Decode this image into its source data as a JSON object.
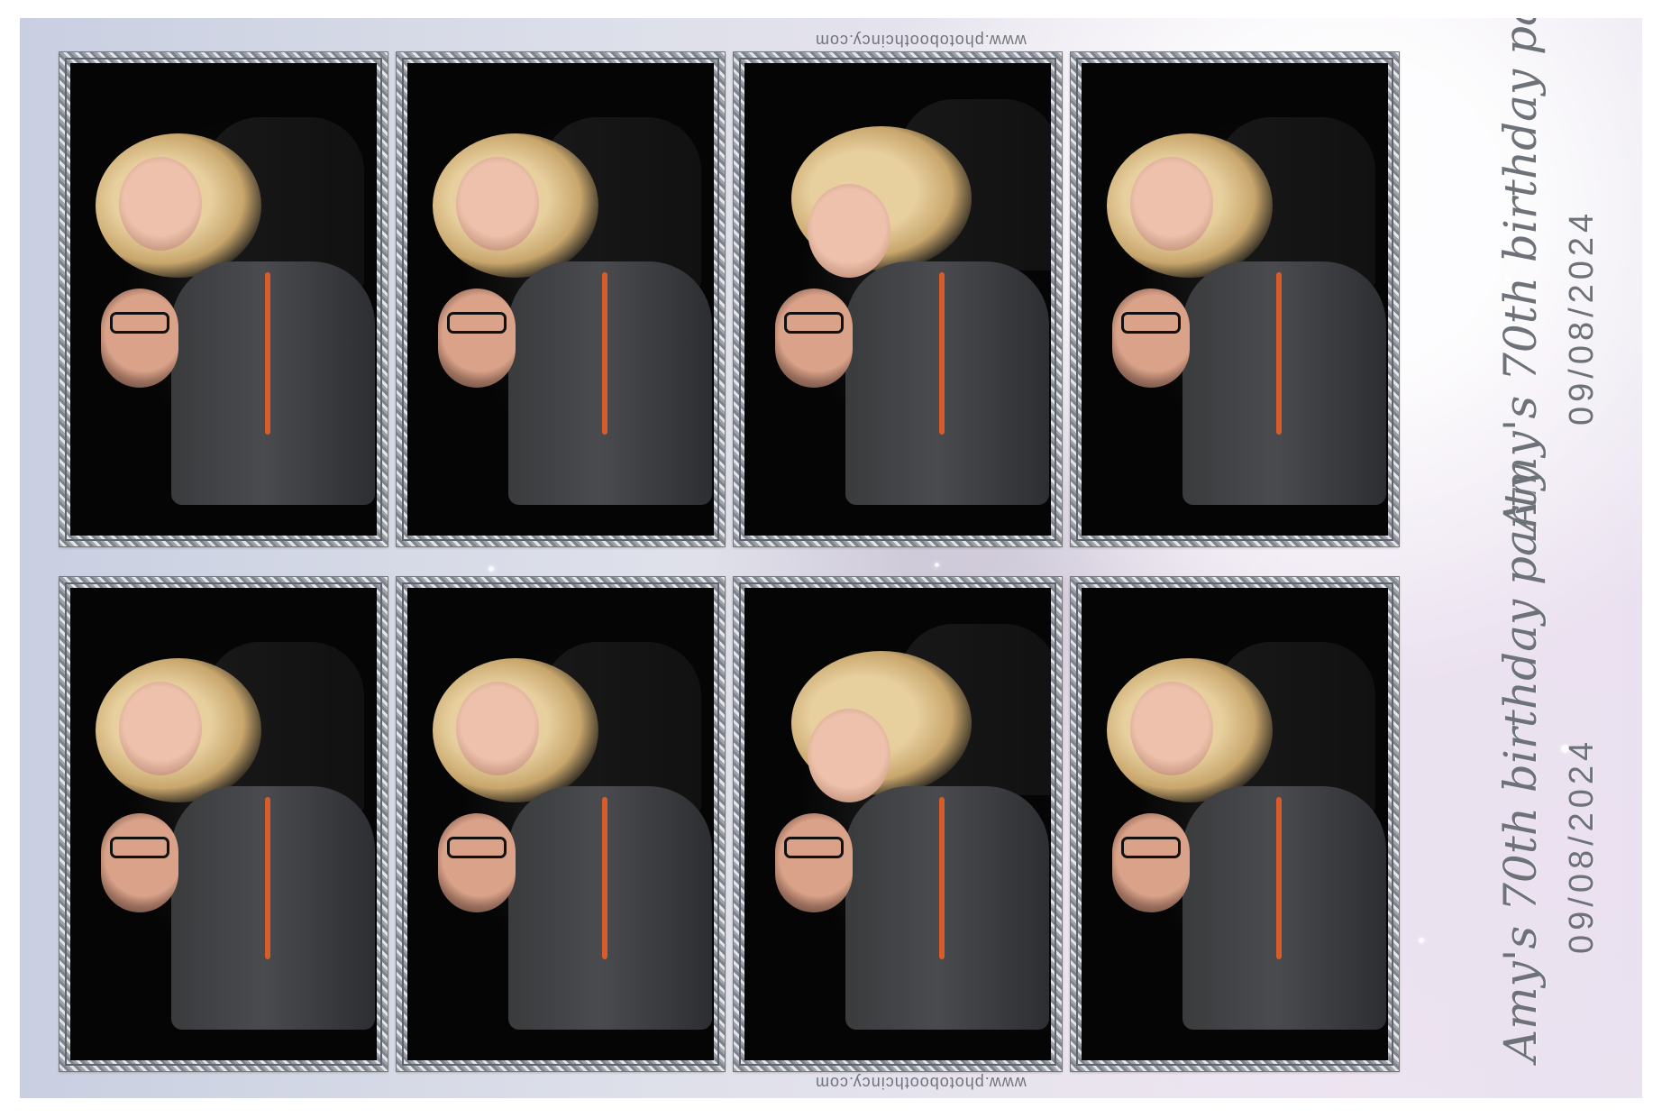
{
  "sheet": {
    "caption": {
      "title": "Amy's 70th birthday party",
      "date": "09/08/2024"
    },
    "watermark": "www.photoboothcincy.com",
    "photos": [
      {
        "label": "couple-smiling-1"
      },
      {
        "label": "couple-smiling-2"
      },
      {
        "label": "couple-kiss"
      },
      {
        "label": "couple-smiling-3"
      },
      {
        "label": "couple-smiling-1"
      },
      {
        "label": "couple-smiling-2"
      },
      {
        "label": "couple-kiss"
      },
      {
        "label": "couple-smiling-3"
      }
    ]
  }
}
